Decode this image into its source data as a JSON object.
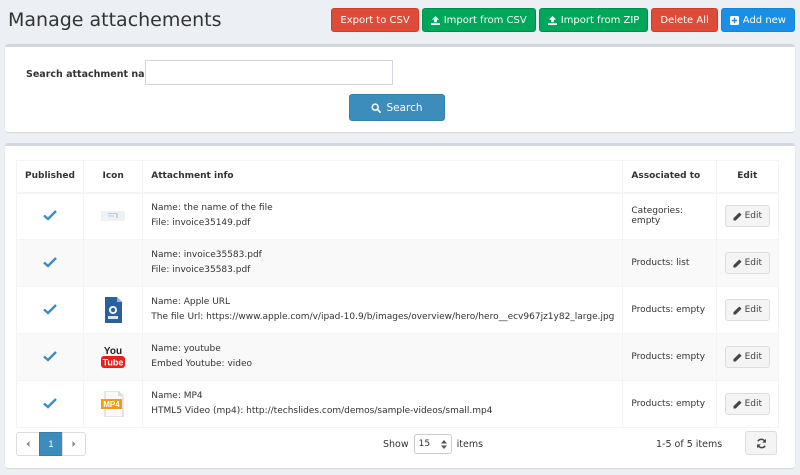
{
  "page": {
    "title": "Manage attachements"
  },
  "toolbar": {
    "export_csv": "Export to CSV",
    "import_csv": "Import from CSV",
    "import_zip": "Import from ZIP",
    "delete_all": "Delete All",
    "add_new": "Add new"
  },
  "search": {
    "label": "Search attachment name",
    "value": "",
    "placeholder": "",
    "button": "Search"
  },
  "table": {
    "headers": [
      "Published",
      "Icon",
      "Attachment info",
      "Associated to",
      "Edit"
    ],
    "rows": [
      {
        "published": true,
        "icon": "file-thumbnail-icon",
        "line1": "Name: the name of the file",
        "line2": "File: invoice35149.pdf",
        "associated": "Categories: empty",
        "edit": "Edit"
      },
      {
        "published": true,
        "icon": "",
        "line1": "Name: invoice35583.pdf",
        "line2": "File: invoice35583.pdf",
        "associated": "Products: list",
        "edit": "Edit"
      },
      {
        "published": true,
        "icon": "image-file-icon",
        "line1": "Name: Apple URL",
        "line2": "The file Url: https://www.apple.com/v/ipad-10.9/b/images/overview/hero/hero__ecv967jz1y82_large.jpg",
        "associated": "Products: empty",
        "edit": "Edit"
      },
      {
        "published": true,
        "icon": "youtube-icon",
        "line1": "Name: youtube",
        "line2": "Embed Youtube: video",
        "associated": "Products: empty",
        "edit": "Edit"
      },
      {
        "published": true,
        "icon": "mp4-file-icon",
        "line1": "Name: MP4",
        "line2": "HTML5 Video (mp4): http://techslides.com/demos/sample-videos/small.mp4",
        "associated": "Products: empty",
        "edit": "Edit"
      }
    ]
  },
  "icon_text": {
    "youtube_you": "You",
    "youtube_tube": "Tube",
    "mp4": "MP4"
  },
  "pagination": {
    "current_page": "1",
    "show_label": "Show",
    "page_size": "15",
    "items_label": "items",
    "range": "1-5 of 5 items"
  },
  "colors": {
    "danger": "#dd4b39",
    "success": "#00a65a",
    "primary": "#3c8dbc",
    "add": "#1a8fe8",
    "check": "#3c8dbc"
  }
}
